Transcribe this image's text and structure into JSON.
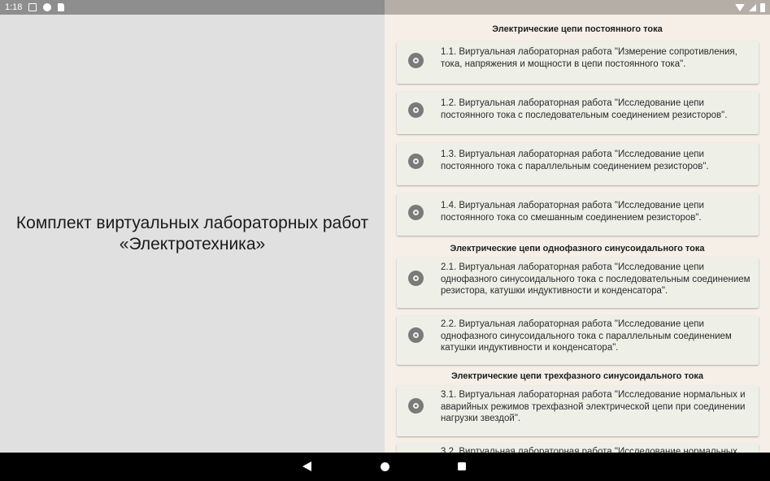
{
  "status_bar": {
    "time": "1:18",
    "icons_left": [
      "a-icon",
      "f-icon",
      "sd-card-icon"
    ],
    "icons_right": [
      "wifi-icon",
      "signal-icon",
      "battery-icon"
    ]
  },
  "left_panel": {
    "title": "Комплект виртуальных лабораторных работ\n«Электротехника»"
  },
  "sections": [
    {
      "title": "Электрические цепи постоянного тока",
      "items": [
        {
          "label": "1.1. Виртуальная лабораторная работа \"Измерение сопротивления, тока, напряжения и мощности в цепи постоянного тока\"."
        },
        {
          "label": "1.2. Виртуальная лабораторная работа \"Исследование цепи постоянного тока с последовательным соединением резисторов\"."
        },
        {
          "label": "1.3. Виртуальная лабораторная работа \"Исследование цепи постоянного тока с параллельным соединением резисторов\"."
        },
        {
          "label": "1.4. Виртуальная лабораторная работа \"Исследование цепи постоянного тока со смешанным соединением резисторов\"."
        }
      ]
    },
    {
      "title": "Электрические цепи однофазного синусоидального тока",
      "items": [
        {
          "label": "2.1. Виртуальная лабораторная работа \"Исследование цепи однофазного синусоидального тока с последовательным соединением резистора, катушки индуктивности и конденсатора\"."
        },
        {
          "label": "2.2. Виртуальная лабораторная работа \"Исследование цепи однофазного синусоидального тока с параллельным соединением катушки индуктивности и конденсатора\"."
        }
      ]
    },
    {
      "title": "Электрические цепи трехфазного синусоидального тока",
      "items": [
        {
          "label": "3.1. Виртуальная лабораторная работа \"Исследование нормальных и аварийных режимов трехфазной электрической цепи при соединении нагрузки звездой\"."
        },
        {
          "label": "3.2. Виртуальная лабораторная работа \"Исследование нормальных"
        }
      ]
    }
  ],
  "nav_bar": {
    "icons": [
      "back-icon",
      "home-icon",
      "recents-icon"
    ]
  }
}
